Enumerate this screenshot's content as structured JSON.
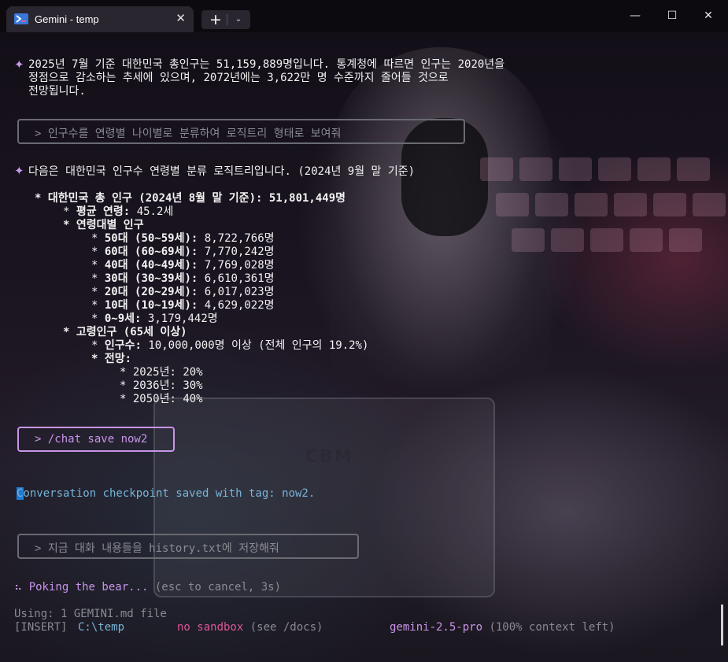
{
  "window": {
    "tab_title": "Gemini - temp",
    "tab_close": "✕",
    "new_tab": "+",
    "tab_menu": "⌄",
    "minimize": "—",
    "maximize": "☐",
    "close": "✕"
  },
  "conversation": {
    "response1": {
      "lines": [
        "2025년 7월 기준 대한민국 총인구는 51,159,889명입니다. 통계청에 따르면 인구는 2020년을",
        "정점으로 감소하는 추세에 있으며, 2072년에는 3,622만 명 수준까지 줄어들 것으로",
        "전망됩니다."
      ]
    },
    "prompt1": "> 인구수를 연령별 나이별로 분류하여 로직트리 형태로 보여줘",
    "response2": {
      "intro": "다음은 대한민국 인구수 연령별 분류 로직트리입니다. (2024년 9월 말 기준)",
      "tree": {
        "root_label": "대한민국 총 인구 (2024년 8월 말 기준):",
        "root_value": "51,801,449명",
        "avg_label": "평균 연령:",
        "avg_value": "45.2세",
        "age_group_label": "연령대별 인구",
        "age_groups": [
          {
            "label": "50대 (50~59세):",
            "value": "8,722,766명"
          },
          {
            "label": "60대 (60~69세):",
            "value": "7,770,242명"
          },
          {
            "label": "40대 (40~49세):",
            "value": "7,769,028명"
          },
          {
            "label": "30대 (30~39세):",
            "value": "6,610,361명"
          },
          {
            "label": "20대 (20~29세):",
            "value": "6,017,023명"
          },
          {
            "label": "10대 (10~19세):",
            "value": "4,629,022명"
          },
          {
            "label": "0~9세:",
            "value": "3,179,442명"
          }
        ],
        "elderly_label": "고령인구 (65세 이상)",
        "elderly_count_label": "인구수:",
        "elderly_count_value": "10,000,000명 이상 (전체 인구의 19.2%)",
        "outlook_label": "전망:",
        "outlook": [
          {
            "label": "2025년:",
            "value": "20%"
          },
          {
            "label": "2036년:",
            "value": "30%"
          },
          {
            "label": "2050년:",
            "value": "40%"
          }
        ]
      }
    },
    "prompt2": "> /chat save now2",
    "status_message": "Conversation checkpoint saved with tag: now2.",
    "input_placeholder": "> 지금 대화 내용들을 history.txt에 저장해줘",
    "spinner_glyph": "⠦",
    "spinner_text": "Poking the bear...",
    "spinner_hint": "(esc to cancel, 3s)"
  },
  "footer": {
    "using": "Using: 1 GEMINI.md file",
    "mode": "[INSERT]",
    "cwd": "C:\\temp",
    "sandbox": "no sandbox",
    "sandbox_hint": "(see /docs)",
    "model": "gemini-2.5-pro",
    "context": "(100% context left)"
  },
  "colors": {
    "accent_purple": "#c894e8",
    "prompt_teal": "#77b4d8",
    "model_purple": "#c894e8",
    "dim": "#8a8a92",
    "cursor_blue": "#1e7bd8"
  }
}
